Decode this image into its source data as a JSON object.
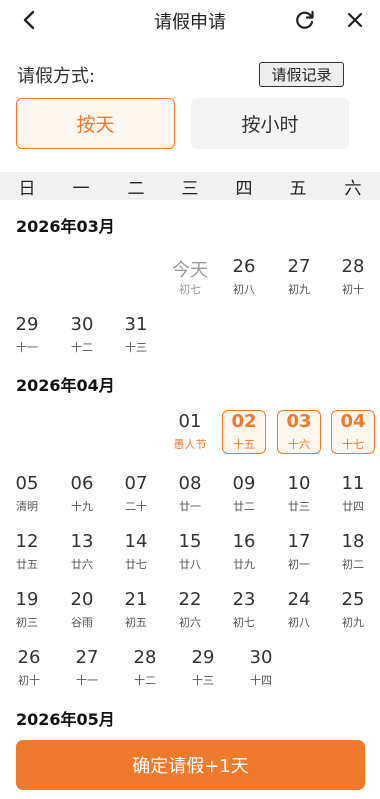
{
  "header": {
    "title": "请假申请",
    "back_icon": "chevron-left-icon",
    "refresh_icon": "refresh-icon",
    "close_icon": "close-icon"
  },
  "method": {
    "label": "请假方式:",
    "record_label": "请假记录",
    "day_label": "按天",
    "hour_label": "按小时",
    "selected": "day"
  },
  "weekdays": [
    "日",
    "一",
    "二",
    "三",
    "四",
    "五",
    "六"
  ],
  "months": [
    {
      "title": "2026年03月",
      "rows": [
        [
          null,
          null,
          null,
          {
            "d": "今天",
            "l": "初七",
            "today": true
          },
          {
            "d": "26",
            "l": "初八"
          },
          {
            "d": "27",
            "l": "初九"
          },
          {
            "d": "28",
            "l": "初十"
          }
        ],
        [
          {
            "d": "29",
            "l": "十一"
          },
          {
            "d": "30",
            "l": "十二"
          },
          {
            "d": "31",
            "l": "十三"
          },
          null,
          null,
          null,
          null
        ]
      ]
    },
    {
      "title": "2026年04月",
      "rows": [
        [
          null,
          null,
          null,
          {
            "d": "01",
            "l": "愚人节",
            "holiday": true
          },
          {
            "d": "02",
            "l": "十五",
            "sel": true
          },
          {
            "d": "03",
            "l": "十六",
            "sel": true
          },
          {
            "d": "04",
            "l": "十七",
            "sel": true
          }
        ],
        [
          {
            "d": "05",
            "l": "清明"
          },
          {
            "d": "06",
            "l": "十九"
          },
          {
            "d": "07",
            "l": "二十"
          },
          {
            "d": "08",
            "l": "廿一"
          },
          {
            "d": "09",
            "l": "廿二"
          },
          {
            "d": "10",
            "l": "廿三"
          },
          {
            "d": "11",
            "l": "廿四"
          }
        ],
        [
          {
            "d": "12",
            "l": "廿五"
          },
          {
            "d": "13",
            "l": "廿六"
          },
          {
            "d": "14",
            "l": "廿七"
          },
          {
            "d": "15",
            "l": "廿八"
          },
          {
            "d": "16",
            "l": "廿九"
          },
          {
            "d": "17",
            "l": "初一"
          },
          {
            "d": "18",
            "l": "初二"
          }
        ],
        [
          {
            "d": "19",
            "l": "初三"
          },
          {
            "d": "20",
            "l": "谷雨"
          },
          {
            "d": "21",
            "l": "初五"
          },
          {
            "d": "22",
            "l": "初六"
          },
          {
            "d": "23",
            "l": "初七"
          },
          {
            "d": "24",
            "l": "初八"
          },
          {
            "d": "25",
            "l": "初九"
          }
        ],
        [
          {
            "d": "26",
            "l": "初十"
          },
          {
            "d": "27",
            "l": "十一"
          },
          {
            "d": "28",
            "l": "十二"
          },
          {
            "d": "29",
            "l": "十三"
          },
          {
            "d": "30",
            "l": "十四"
          },
          null,
          null
        ]
      ]
    },
    {
      "title": "2026年05月",
      "rows": []
    }
  ],
  "footer": {
    "confirm_label": "确定请假+1天"
  },
  "colors": {
    "accent": "#f07a2c",
    "accent_bg": "#fff6ef"
  }
}
